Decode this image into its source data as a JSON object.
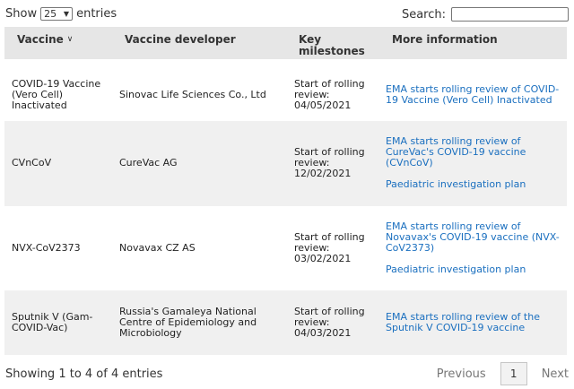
{
  "length_control": {
    "prefix": "Show",
    "selected": "25",
    "suffix": "entries"
  },
  "search": {
    "label": "Search:",
    "value": ""
  },
  "columns": [
    "Vaccine",
    "Vaccine developer",
    "Key milestones",
    "More information"
  ],
  "rows": [
    {
      "vaccine": "COVID-19 Vaccine (Vero Cell) Inactivated",
      "developer": "Sinovac Life Sciences Co., Ltd",
      "milestone": "Start of rolling review: 04/05/2021",
      "links": [
        "EMA starts rolling review of COVID-19 Vaccine (Vero Cell) Inactivated"
      ]
    },
    {
      "vaccine": "CVnCoV",
      "developer": "CureVac AG",
      "milestone": "Start of rolling review: 12/02/2021",
      "links": [
        "EMA starts rolling review of CureVac's COVID-19 vaccine (CVnCoV)",
        "Paediatric investigation plan"
      ]
    },
    {
      "vaccine": "NVX-CoV2373",
      "developer": "Novavax CZ AS",
      "milestone": "Start of rolling review: 03/02/2021",
      "links": [
        "EMA starts rolling review of Novavax's COVID-19 vaccine (NVX-CoV2373)",
        "Paediatric investigation plan"
      ]
    },
    {
      "vaccine": "Sputnik V (Gam-COVID-Vac)",
      "developer": "Russia's Gamaleya National Centre of Epidemiology and Microbiology",
      "milestone": "Start of rolling review: 04/03/2021",
      "links": [
        "EMA starts rolling review of the Sputnik V COVID-19 vaccine"
      ]
    }
  ],
  "footer": {
    "info": "Showing 1 to 4 of 4 entries",
    "previous": "Previous",
    "current_page": "1",
    "next": "Next"
  }
}
